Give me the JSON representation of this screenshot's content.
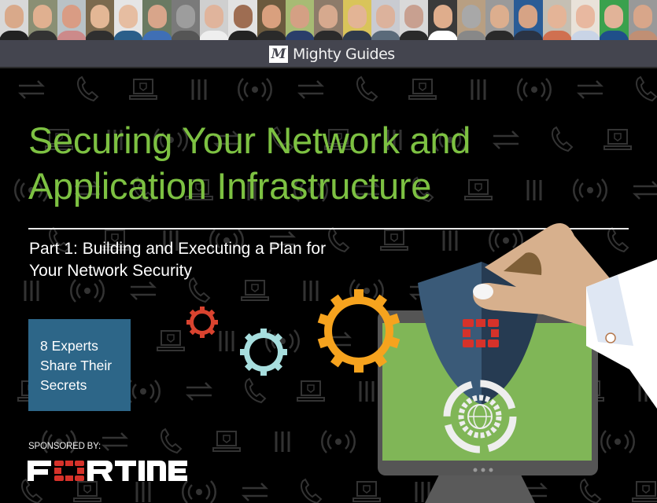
{
  "header": {
    "expert_photos_count": 23,
    "brand_logo_letter": "M",
    "brand_name": "Mighty Guides"
  },
  "title": {
    "line1": "Securing Your Network and",
    "line2": "Application Infrastructure"
  },
  "subtitle": {
    "line1": "Part 1: Building and Executing a Plan for",
    "line2": "Your Network Security"
  },
  "callout": {
    "line1": "8 Experts",
    "line2": "Share Their",
    "line3": "Secrets"
  },
  "sponsor": {
    "label": "SPONSORED BY:",
    "name": "FORTINET"
  },
  "colors": {
    "title_green": "#7dc142",
    "callout_blue": "#2d6688",
    "brandbar_gray": "#44454f",
    "fortinet_red": "#d6322a",
    "gear_orange": "#f6a31e",
    "gear_red": "#d9432f",
    "gear_teal": "#a7dede",
    "screen_green": "#80b657",
    "shield_blue": "#3a5a78"
  },
  "icons": [
    "expert-photo",
    "mighty-guides-logo",
    "swap-arrows-icon",
    "phone-icon",
    "laptop-shield-icon",
    "wireless-signal-icon",
    "bars-icon",
    "gear-icon",
    "shield-icon",
    "monitor-icon",
    "hand-icon",
    "cycle-arrows-icon",
    "fortinet-logo"
  ]
}
